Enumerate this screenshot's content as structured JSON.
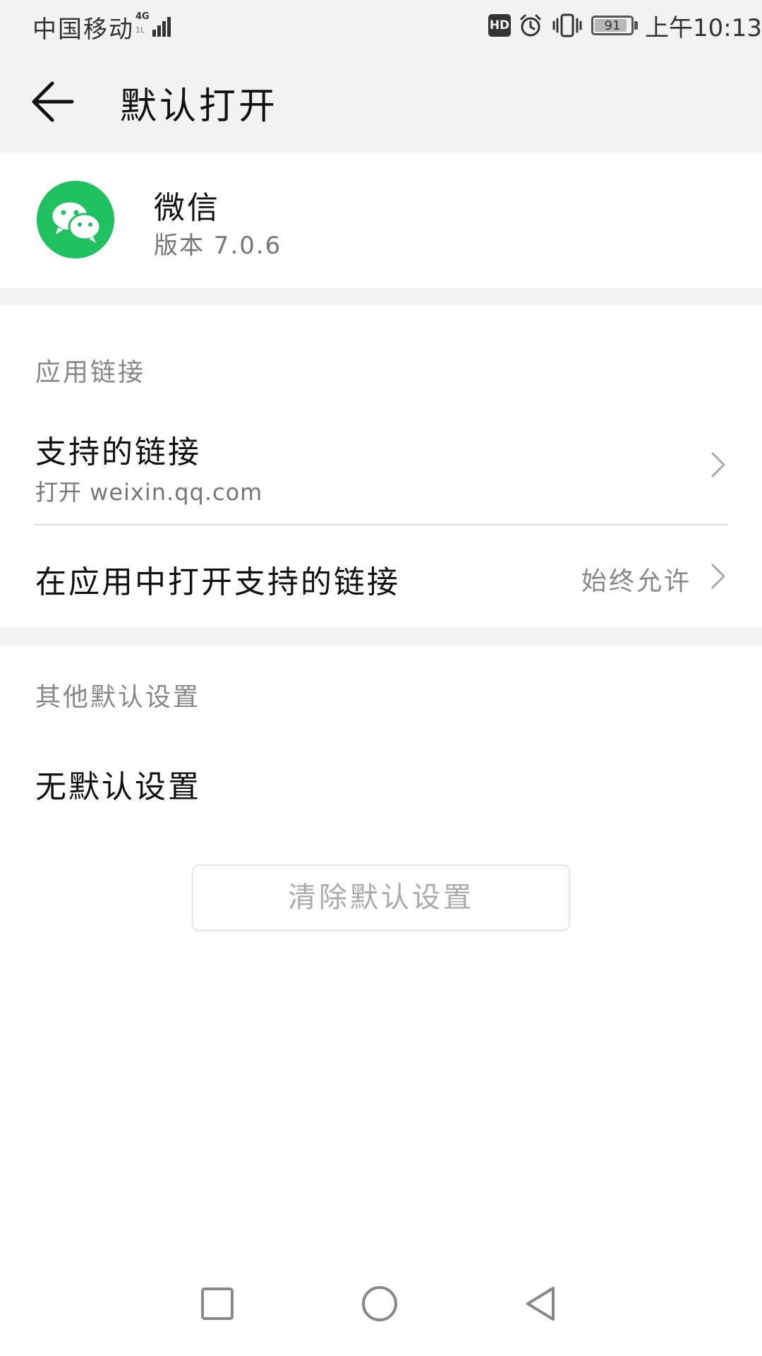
{
  "status_bar": {
    "carrier": "中国移动",
    "network_type": "4G",
    "network_sub": "1L",
    "hd_label": "HD",
    "battery_level": "91",
    "battery_fraction": 0.91,
    "time": "上午10:13",
    "icons": [
      "signal-icon",
      "alarm-icon",
      "vibrate-icon",
      "battery-icon"
    ]
  },
  "header": {
    "title": "默认打开",
    "back_icon": "back-arrow-icon"
  },
  "app": {
    "name": "微信",
    "version": "版本 7.0.6",
    "icon": "wechat-icon",
    "brand_color": "#20c160"
  },
  "app_links": {
    "section_title": "应用链接",
    "supported_links": {
      "title": "支持的链接",
      "subtitle": "打开 weixin.qq.com"
    },
    "open_in_app": {
      "title": "在应用中打开支持的链接",
      "value": "始终允许"
    }
  },
  "other_defaults": {
    "section_title": "其他默认设置",
    "text": "无默认设置",
    "clear_button_label": "清除默认设置"
  },
  "nav_bar": {
    "icons": [
      "recent-apps-icon",
      "home-icon",
      "back-icon"
    ]
  }
}
